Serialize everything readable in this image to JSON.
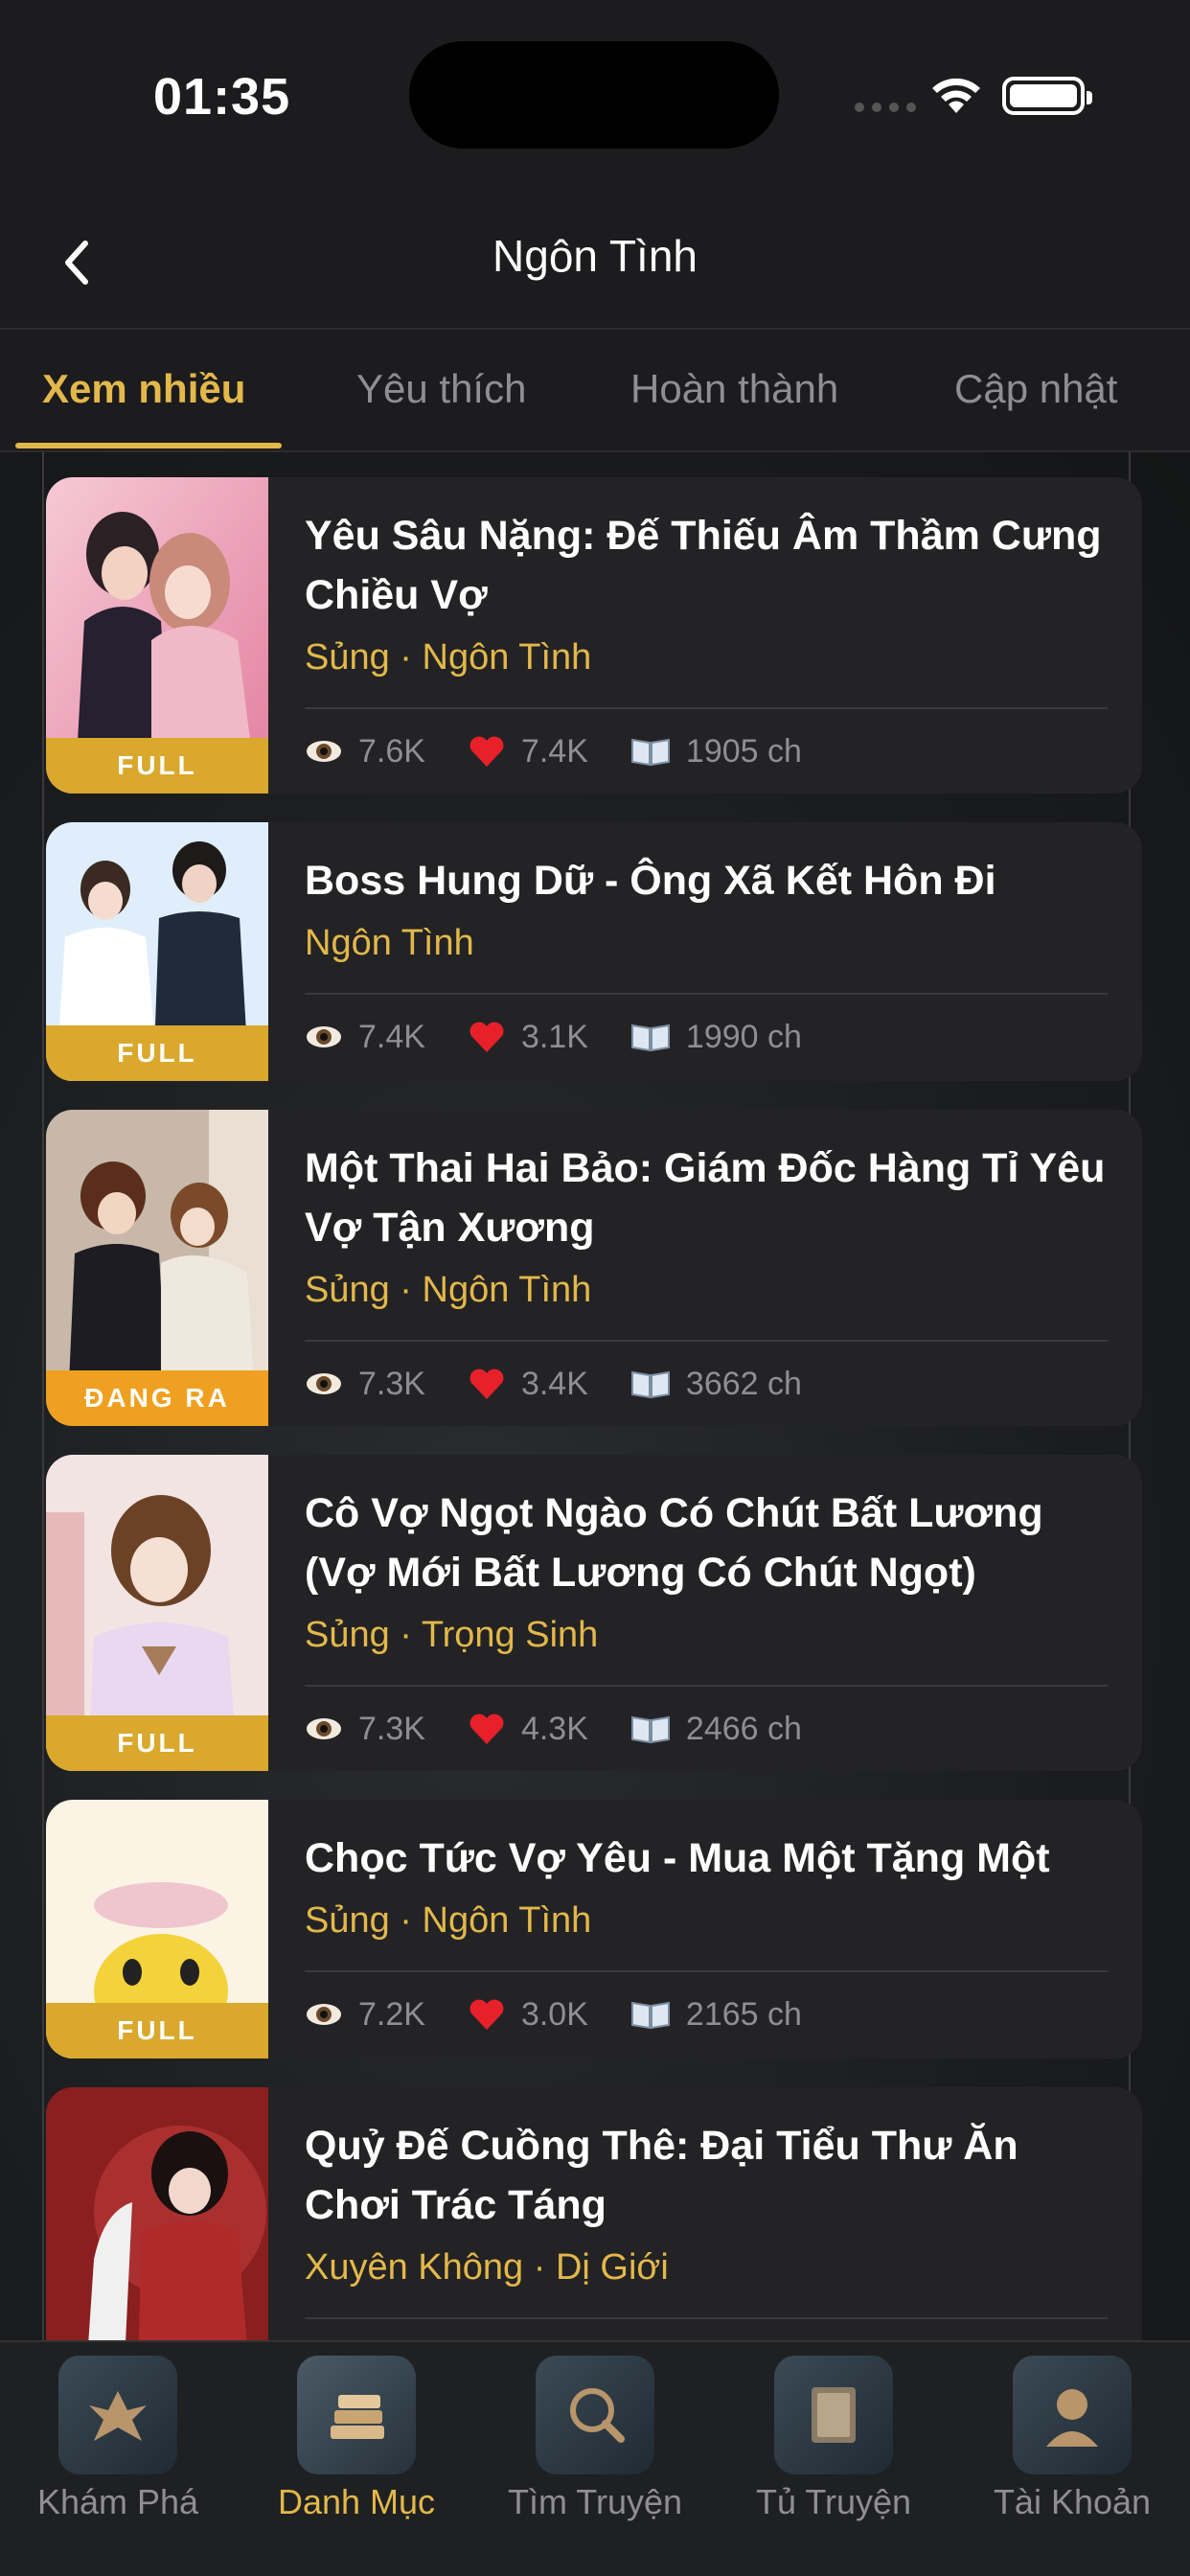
{
  "status_bar": {
    "time": "01:35"
  },
  "nav": {
    "title": "Ngôn Tình",
    "back_icon": "chevron-left-icon"
  },
  "tabs": [
    {
      "label": "Xem nhiều",
      "active": true
    },
    {
      "label": "Yêu thích",
      "active": false
    },
    {
      "label": "Hoàn thành",
      "active": false
    },
    {
      "label": "Cập nhật",
      "active": false
    }
  ],
  "stories": [
    {
      "title": "Yêu Sâu Nặng: Đế Thiếu Âm Thầm Cưng Chiều Vợ",
      "genre": "Sủng · Ngôn Tình",
      "views": "7.6K",
      "likes": "7.4K",
      "chapters": "1905 ch",
      "badge": "FULL"
    },
    {
      "title": "Boss Hung Dữ - Ông Xã Kết Hôn Đi",
      "genre": "Ngôn Tình",
      "views": "7.4K",
      "likes": "3.1K",
      "chapters": "1990 ch",
      "badge": "FULL"
    },
    {
      "title": "Một Thai Hai Bảo: Giám Đốc Hàng Tỉ Yêu Vợ Tận Xương",
      "genre": "Sủng · Ngôn Tình",
      "views": "7.3K",
      "likes": "3.4K",
      "chapters": "3662 ch",
      "badge": "ĐANG RA"
    },
    {
      "title": "Cô Vợ Ngọt Ngào Có Chút Bất Lương (Vợ Mới Bất Lương Có Chút Ngọt)",
      "genre": "Sủng · Trọng Sinh",
      "views": "7.3K",
      "likes": "4.3K",
      "chapters": "2466 ch",
      "badge": "FULL"
    },
    {
      "title": "Chọc Tức Vợ Yêu - Mua Một Tặng Một",
      "genre": "Sủng · Ngôn Tình",
      "views": "7.2K",
      "likes": "3.0K",
      "chapters": "2165 ch",
      "badge": "FULL"
    },
    {
      "title": "Quỷ Đế Cuồng Thê: Đại Tiểu Thư Ăn Chơi Trác Táng",
      "genre": "Xuyên Không · Dị Giới",
      "views": "",
      "likes": "",
      "chapters": "",
      "badge": ""
    }
  ],
  "bottom_tabs": [
    {
      "label": "Khám Phá",
      "icon": "explore-phoenix-icon",
      "active": false
    },
    {
      "label": "Danh Mục",
      "icon": "books-stack-icon",
      "active": true
    },
    {
      "label": "Tìm Truyện",
      "icon": "magnifier-book-icon",
      "active": false
    },
    {
      "label": "Tủ Truyện",
      "icon": "bookshelf-icon",
      "active": false
    },
    {
      "label": "Tài Khoản",
      "icon": "account-avatar-icon",
      "active": false
    }
  ],
  "colors": {
    "accent": "#e3b84a",
    "background": "#1c1c1e",
    "card": "#232325",
    "muted": "#8e8e93",
    "badge_full": "#d9a82c",
    "badge_ongoing": "#f0a020"
  }
}
